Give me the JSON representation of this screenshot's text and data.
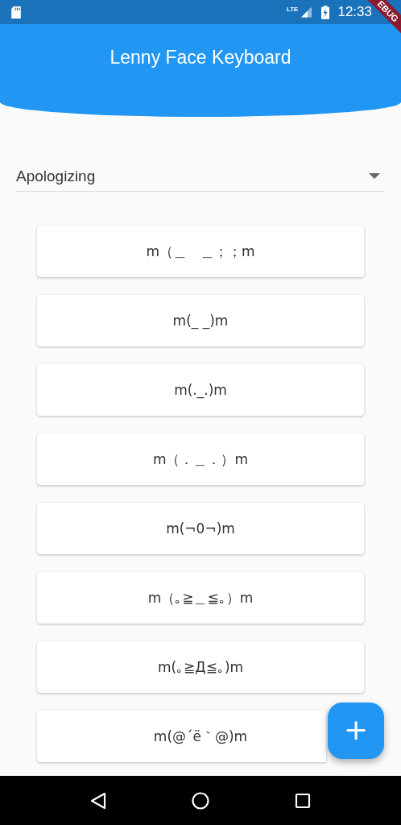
{
  "status_bar": {
    "time": "12:33",
    "network": "LTE"
  },
  "debug_banner": "EBUG",
  "app_bar": {
    "title": "Lenny Face Keyboard"
  },
  "category_dropdown": {
    "value": "Apologizing"
  },
  "faces": [
    {
      "text": "m（＿　＿；；m"
    },
    {
      "text": "m(_ _)m"
    },
    {
      "text": "m(._.)m"
    },
    {
      "text": "m（．＿．）m"
    },
    {
      "text": "m(¬0¬)m"
    },
    {
      "text": "m（｡≧＿≦｡）m"
    },
    {
      "text": "m(｡≧Д≦｡)m"
    },
    {
      "text": "m(@´ë｀@)m"
    }
  ],
  "fab": {
    "label": "+"
  }
}
